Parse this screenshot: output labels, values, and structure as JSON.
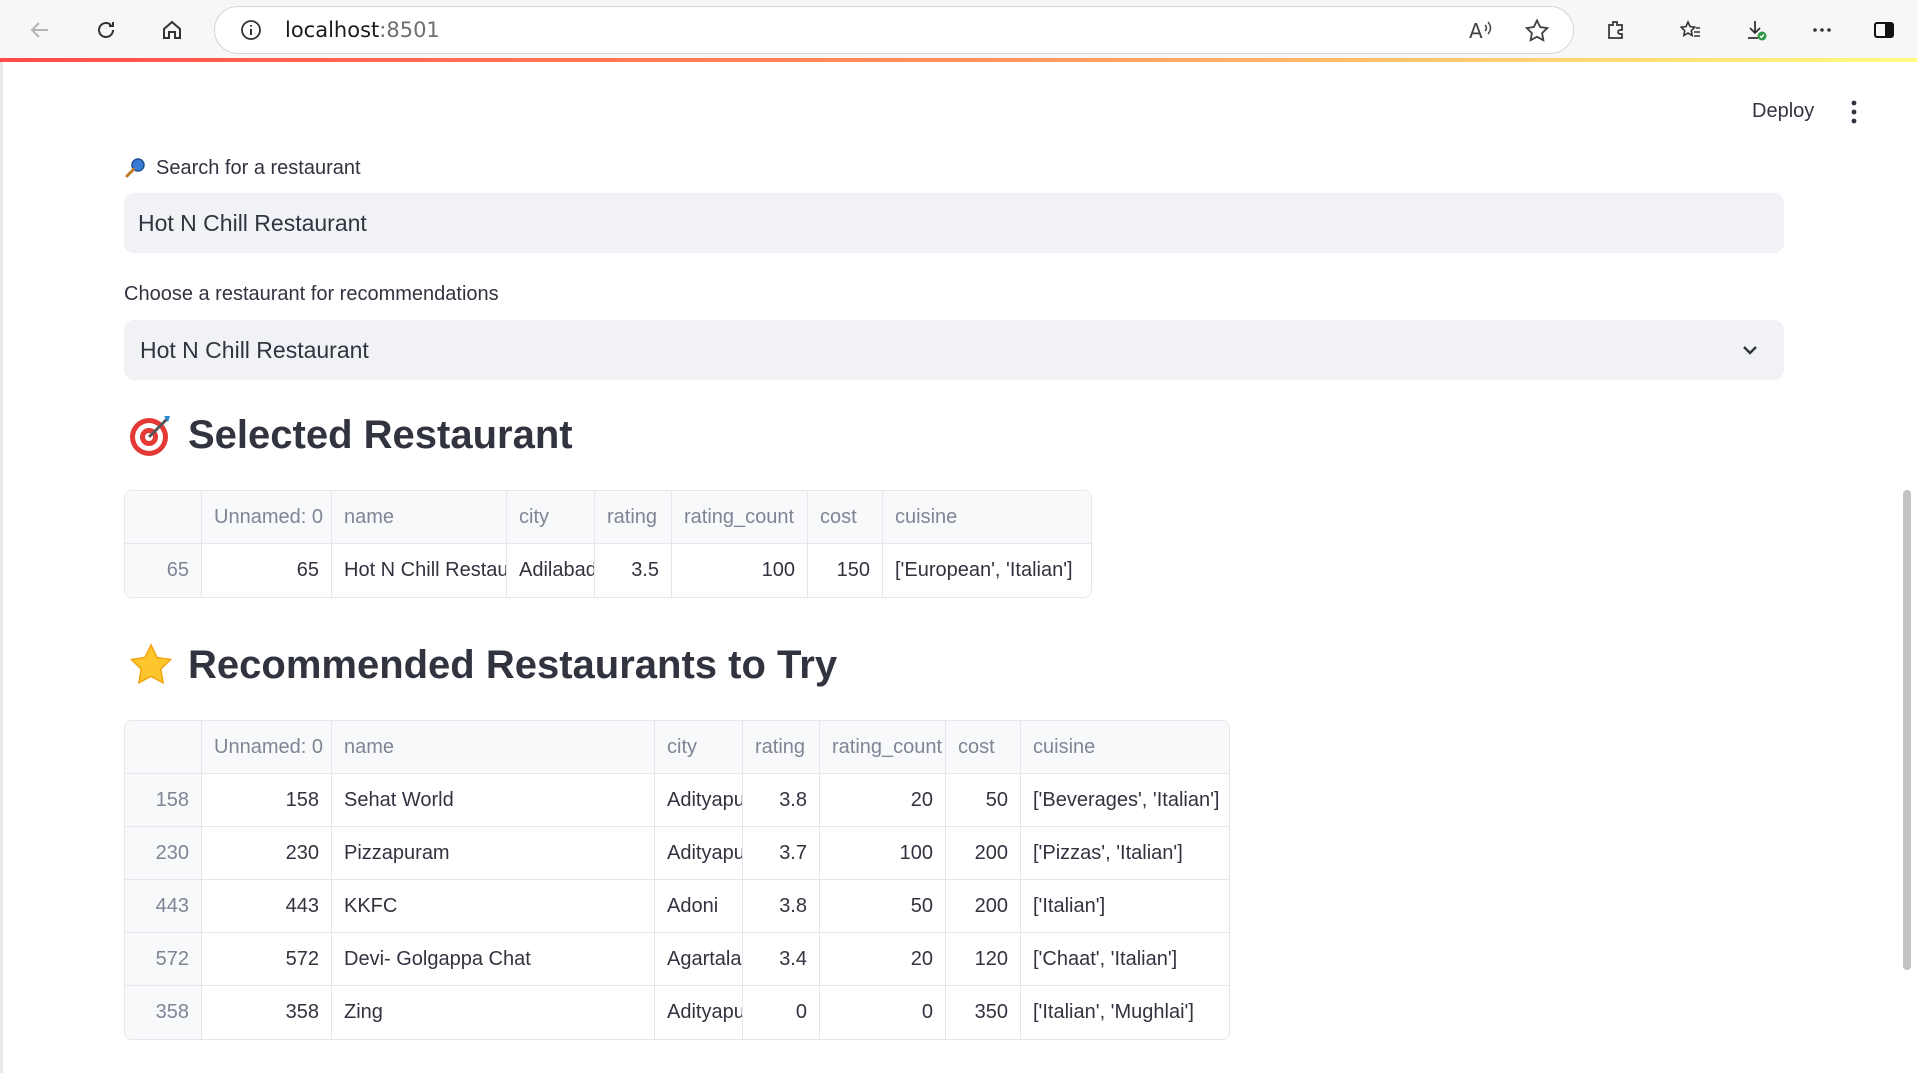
{
  "browser": {
    "url_host": "localhost",
    "url_port": ":8501"
  },
  "header": {
    "deploy_label": "Deploy"
  },
  "search": {
    "label": "Search for a restaurant",
    "value": "Hot N Chill Restaurant"
  },
  "choose": {
    "label": "Choose a restaurant for recommendations",
    "value": "Hot N Chill Restaurant"
  },
  "selected": {
    "heading": "Selected Restaurant",
    "columns": [
      "",
      "Unnamed: 0",
      "name",
      "city",
      "rating",
      "rating_count",
      "cost",
      "cuisine"
    ],
    "rows": [
      [
        "65",
        "65",
        "Hot N Chill Restaur",
        "Adilabad",
        "3.5",
        "100",
        "150",
        "['European', 'Italian']"
      ]
    ]
  },
  "recommended": {
    "heading": "Recommended Restaurants to Try",
    "columns": [
      "",
      "Unnamed: 0",
      "name",
      "city",
      "rating",
      "rating_count",
      "cost",
      "cuisine"
    ],
    "rows": [
      [
        "158",
        "158",
        "Sehat World",
        "Adityapu",
        "3.8",
        "20",
        "50",
        "['Beverages', 'Italian']"
      ],
      [
        "230",
        "230",
        "Pizzapuram",
        "Adityapu",
        "3.7",
        "100",
        "200",
        "['Pizzas', 'Italian']"
      ],
      [
        "443",
        "443",
        "KKFC",
        "Adoni",
        "3.8",
        "50",
        "200",
        "['Italian']"
      ],
      [
        "572",
        "572",
        "Devi- Golgappa Chat",
        "Agartala",
        "3.4",
        "20",
        "120",
        "['Chaat', 'Italian']"
      ],
      [
        "358",
        "358",
        "Zing",
        "Adityapu",
        "0",
        "0",
        "350",
        "['Italian', 'Mughlai']"
      ]
    ]
  },
  "icons": {
    "search_label_icon": "magnifier-icon",
    "selected_heading_icon": "target-icon",
    "recommended_heading_icon": "star-icon"
  }
}
